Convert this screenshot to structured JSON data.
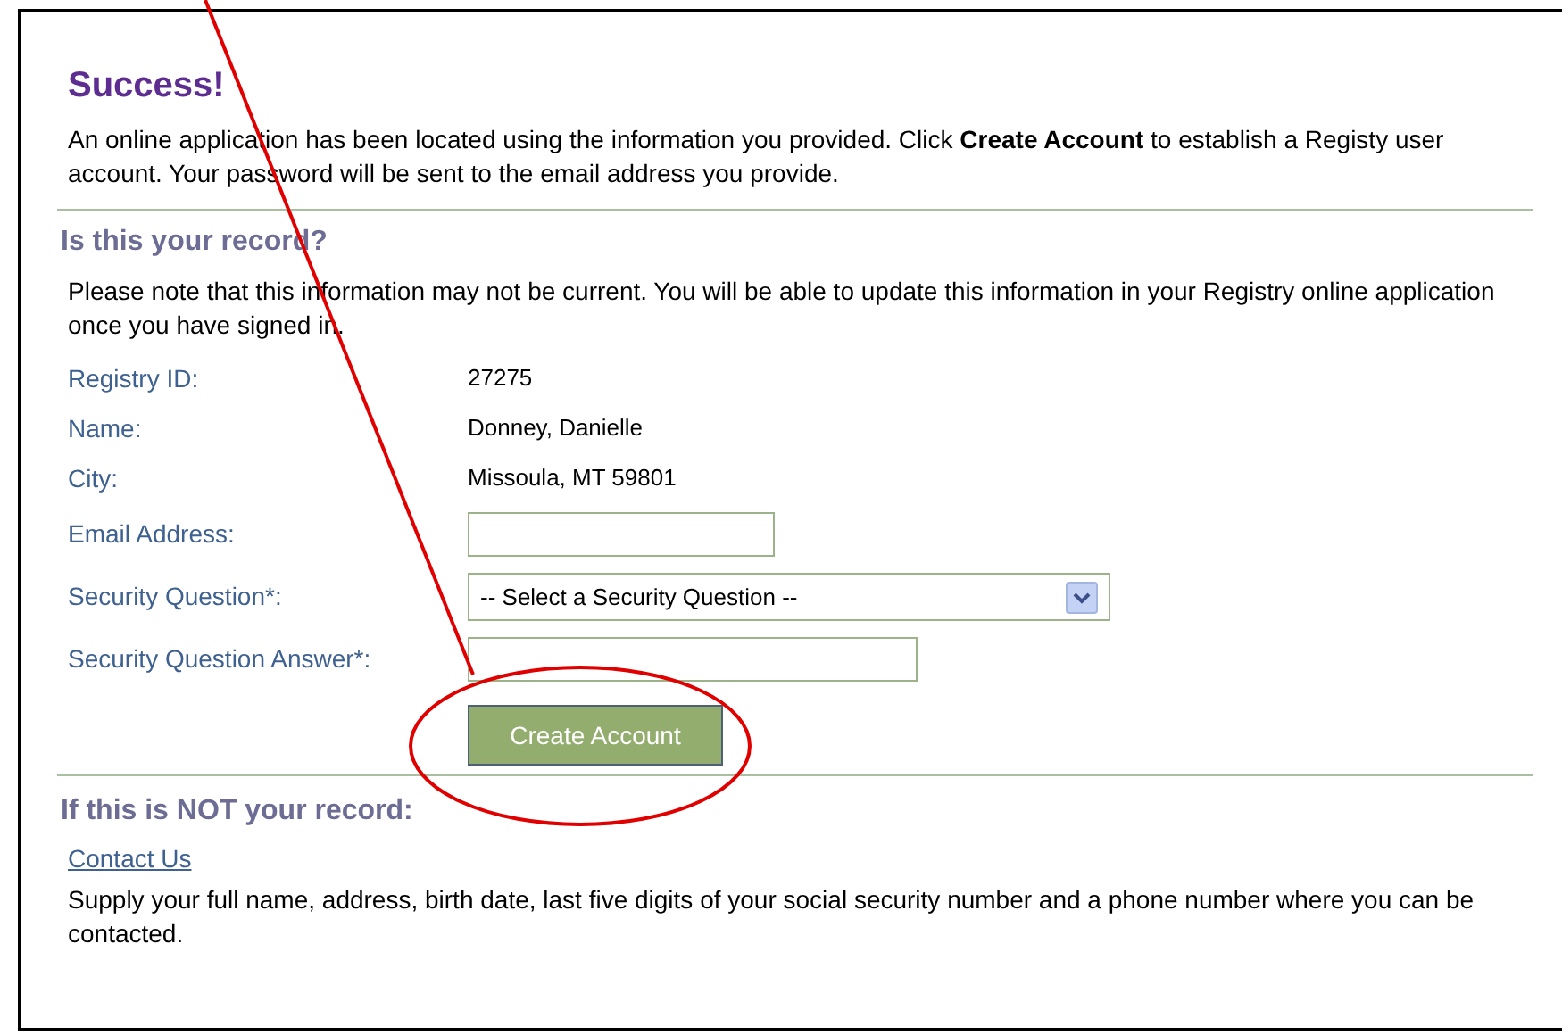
{
  "title": "Success!",
  "intro": "An online application has been located using the information you provided.  Click **Create Account** to establish a Registy user account. Your password will be sent to the email address you provide.",
  "record_section": {
    "heading": "Is this your record?",
    "note": "Please note that this information may not be current. You will be able to update this information in your Registry online application once you have signed in.",
    "fields": [
      {
        "kind": "text",
        "label": "Registry ID:",
        "value": "27275"
      },
      {
        "kind": "text",
        "label": "Name:",
        "value": "Donney, Danielle"
      },
      {
        "kind": "text",
        "label": "City:",
        "value": "Missoula, MT 59801"
      },
      {
        "kind": "input",
        "label": "Email Address:"
      },
      {
        "kind": "select",
        "label": "Security Question*:",
        "value": "-- Select a Security Question --"
      },
      {
        "kind": "input",
        "label": "Security Question Answer*:"
      }
    ],
    "button": "Create Account"
  },
  "not_record_section": {
    "heading": "If this is NOT your record:",
    "link": "Contact Us",
    "note": "Supply your full name, address, birth date, last five digits of your social security number and a phone number where you can be contacted."
  }
}
